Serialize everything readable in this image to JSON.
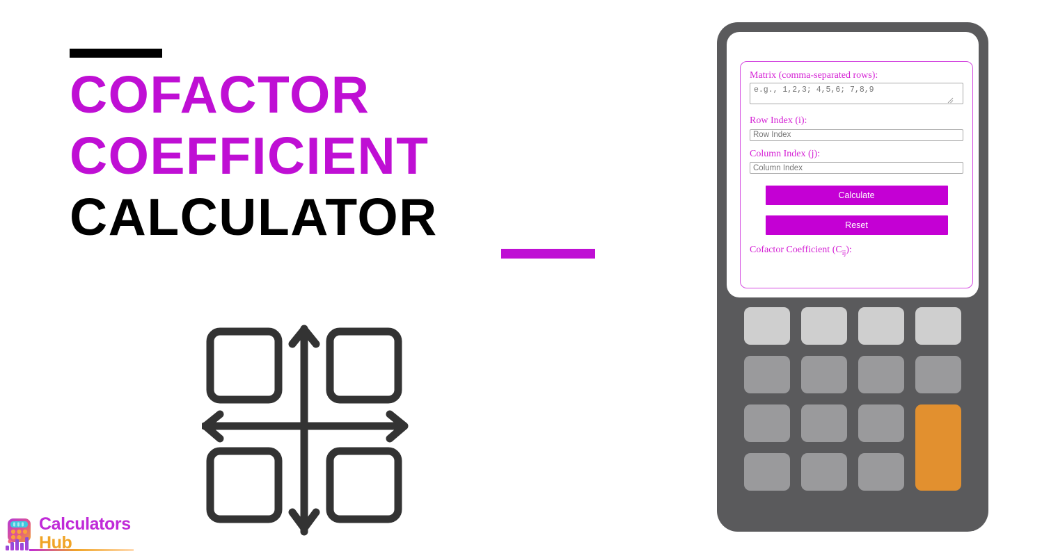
{
  "page": {
    "background_color": "#ffffff",
    "accent_purple": "#bf0fd4",
    "accent_magenta": "#c400d4",
    "device_gray": "#5a5a5c",
    "key_orange": "#e2902f"
  },
  "hero": {
    "top_rule": "",
    "line1": "COFACTOR",
    "line2": "COEFFICIENT",
    "line3": "CALCULATOR",
    "bottom_rule": ""
  },
  "illustration": {
    "name": "four-quadrant-axes-icon",
    "stroke_color": "#333333"
  },
  "device": {
    "form": {
      "matrix": {
        "label": "Matrix (comma-separated rows):",
        "placeholder": "e.g., 1,2,3; 4,5,6; 7,8,9",
        "value": ""
      },
      "row_index": {
        "label": "Row Index (i):",
        "placeholder": "Row Index",
        "value": ""
      },
      "column_index": {
        "label": "Column Index (j):",
        "placeholder": "Column Index",
        "value": ""
      },
      "calculate_label": "Calculate",
      "reset_label": "Reset",
      "result": {
        "label_prefix": "Cofactor Coefficient (C",
        "label_sub": "ij",
        "label_suffix": "):",
        "value": ""
      }
    },
    "keypad": {
      "rows": [
        [
          {
            "name": "key-r1c1",
            "style": "light"
          },
          {
            "name": "key-r1c2",
            "style": "light"
          },
          {
            "name": "key-r1c3",
            "style": "light"
          },
          {
            "name": "key-r1c4",
            "style": "light"
          }
        ],
        [
          {
            "name": "key-r2c1",
            "style": "normal"
          },
          {
            "name": "key-r2c2",
            "style": "normal"
          },
          {
            "name": "key-r2c3",
            "style": "normal"
          },
          {
            "name": "key-r2c4",
            "style": "normal"
          }
        ],
        [
          {
            "name": "key-r3c1",
            "style": "normal"
          },
          {
            "name": "key-r3c2",
            "style": "normal"
          },
          {
            "name": "key-r3c3",
            "style": "normal"
          },
          {
            "name": "key-equals",
            "style": "orange"
          }
        ],
        [
          {
            "name": "key-r4c1",
            "style": "normal"
          },
          {
            "name": "key-r4c2",
            "style": "normal"
          },
          {
            "name": "key-r4c3",
            "style": "normal"
          }
        ]
      ]
    }
  },
  "logo": {
    "word1": "Calculators",
    "word2": "Hub",
    "mark_name": "calculator-chart-logo-icon"
  }
}
